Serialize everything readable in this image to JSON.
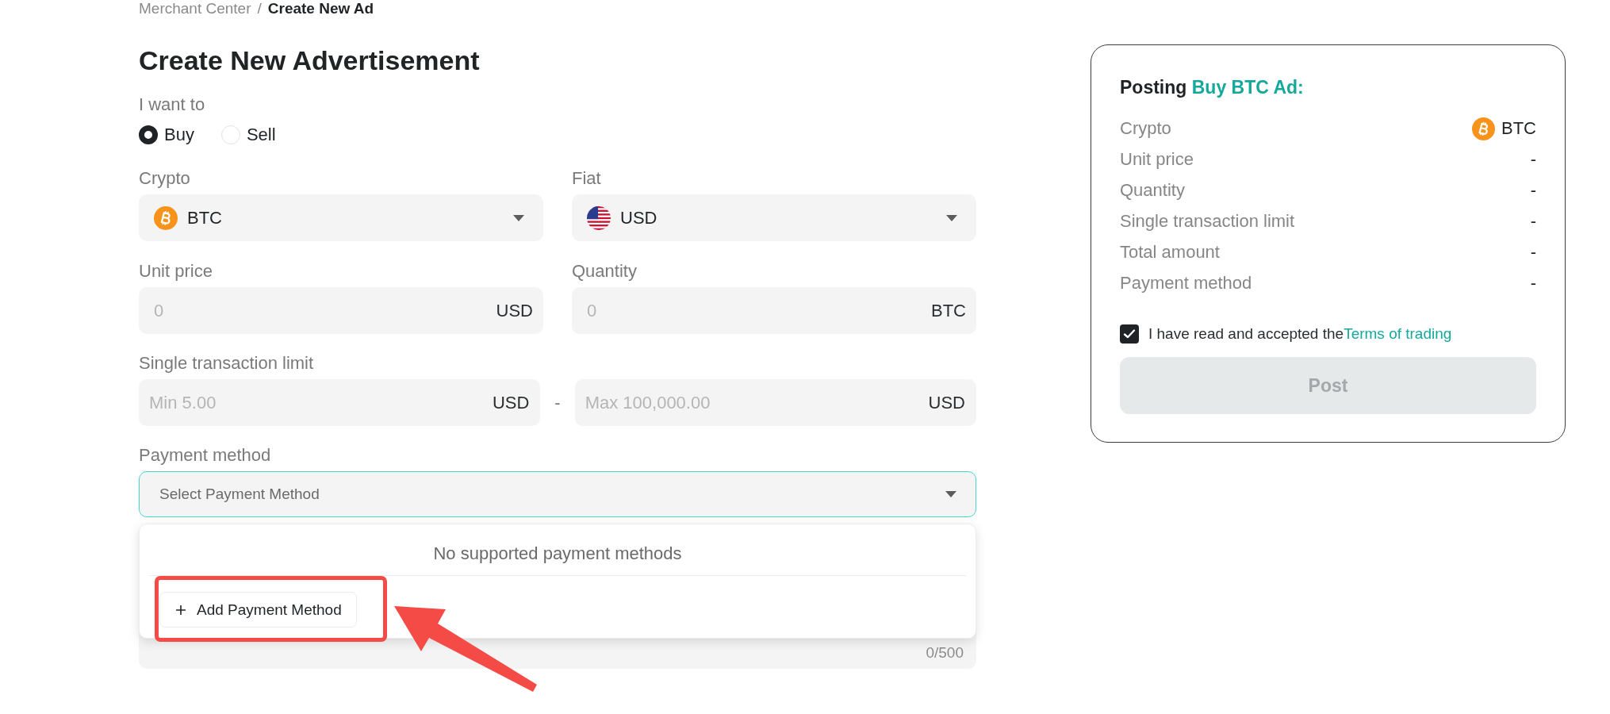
{
  "breadcrumb": {
    "items": [
      {
        "label": "Merchant Center",
        "current": false
      },
      {
        "label": "Create New Ad",
        "current": true
      }
    ],
    "separator": "/"
  },
  "form": {
    "title": "Create New Advertisement",
    "side": {
      "label": "I want to",
      "options": [
        {
          "label": "Buy",
          "selected": true
        },
        {
          "label": "Sell",
          "selected": false
        }
      ]
    },
    "selects": [
      {
        "label": "Crypto",
        "value": "BTC",
        "kind": "coin"
      },
      {
        "label": "Fiat",
        "value": "USD",
        "kind": "flag"
      }
    ],
    "amounts": [
      {
        "label": "Unit price",
        "placeholder": "0",
        "unit": "USD"
      },
      {
        "label": "Quantity",
        "placeholder": "0",
        "unit": "BTC"
      }
    ],
    "limit": {
      "label": "Single transaction limit",
      "min": {
        "placeholder": "Min 5.00",
        "unit": "USD"
      },
      "separator": "-",
      "max": {
        "placeholder": "Max 100,000.00",
        "unit": "USD"
      }
    },
    "payment_method": {
      "label": "Payment method",
      "placeholder": "Select Payment Method",
      "expanded": true,
      "dropdown": {
        "message": "No supported payment methods",
        "add_button": "Add Payment Method"
      }
    },
    "remarks": {
      "counter": "0/500"
    }
  },
  "summary": {
    "title": "Posting",
    "title_highlight": "Buy BTC Ad:",
    "rows": [
      {
        "label": "Crypto",
        "value": "BTC",
        "kind": "coin"
      },
      {
        "label": "Unit price",
        "value": "-",
        "kind": "text"
      },
      {
        "label": "Quantity",
        "value": "-",
        "kind": "text"
      },
      {
        "label": "Single transaction limit",
        "value": "-",
        "kind": "text"
      },
      {
        "label": "Total amount",
        "value": "-",
        "kind": "text"
      },
      {
        "label": "Payment method",
        "value": "-",
        "kind": "text"
      }
    ],
    "agreement": {
      "checked": true,
      "text": "I have read and accepted the",
      "link": "Terms of trading"
    },
    "post_button": {
      "label": "Post",
      "disabled": true
    }
  }
}
